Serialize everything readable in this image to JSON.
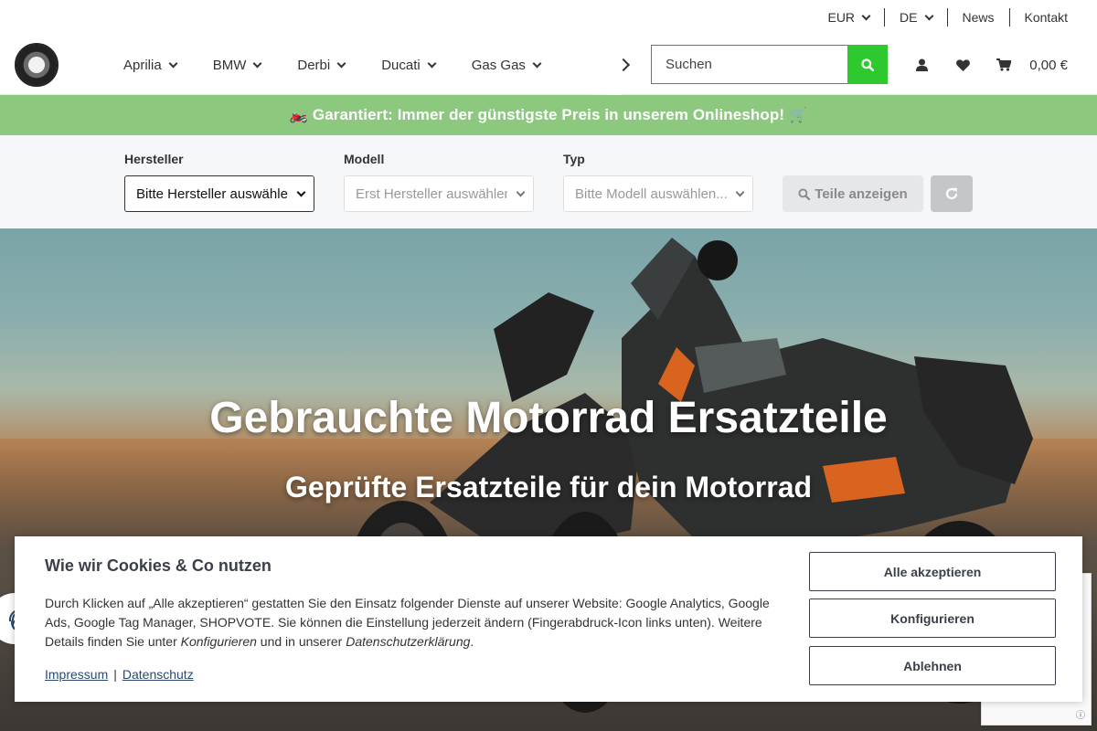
{
  "topbar": {
    "currency": "EUR",
    "language": "DE",
    "news": "News",
    "contact": "Kontakt"
  },
  "nav": {
    "items": [
      "Aprilia",
      "BMW",
      "Derbi",
      "Ducati",
      "Gas Gas"
    ]
  },
  "search": {
    "placeholder": "Suchen"
  },
  "header": {
    "cart_total": "0,00 €"
  },
  "promo": {
    "text": "Garantiert: Immer der günstigste Preis in unserem Onlineshop!",
    "emoji_left": "🏍️",
    "emoji_right": "🛒"
  },
  "filter": {
    "manufacturer_label": "Hersteller",
    "manufacturer_value": "Bitte Hersteller auswählen",
    "model_label": "Modell",
    "model_value": "Erst Hersteller auswählen",
    "type_label": "Typ",
    "type_value": "Bitte Modell auswählen...",
    "show_parts_button": "Teile anzeigen"
  },
  "hero": {
    "title": "Gebrauchte Motorrad Ersatzteile",
    "subtitle": "Geprüfte Ersatzteile für dein Motorrad"
  },
  "cookie": {
    "title": "Wie wir Cookies & Co nutzen",
    "text_part1": "Durch Klicken auf „Alle akzeptieren“ gestatten Sie den Einsatz folgender Dienste auf unserer Website: Google Analytics, Google Ads, Google Tag Manager, SHOPVOTE. Sie können die Einstellung jederzeit ändern (Fingerabdruck-Icon links unten). Weitere Details finden Sie unter ",
    "text_configure": "Konfigurieren",
    "text_part2": " und in unserer ",
    "text_privacy": "Datenschutzerklärung",
    "text_part3": ".",
    "link_imprint": "Impressum",
    "link_separator": "|",
    "link_privacy": "Datenschutz",
    "accept_all": "Alle akzeptieren",
    "configure": "Konfigurieren",
    "decline": "Ablehnen"
  },
  "colors": {
    "search_button": "#2ec92e",
    "promo_background": "#8cc97f",
    "cookie_text": "#3a3f4a"
  }
}
